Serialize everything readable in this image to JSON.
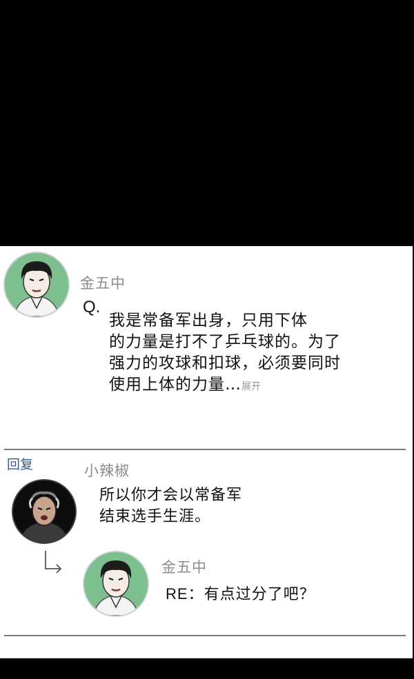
{
  "comment": {
    "username": "金五中",
    "q_prefix": "Q.",
    "lines": [
      "我是常备军出身，只用下体",
      "的力量是打不了乒乓球的。为了",
      "强力的攻球和扣球，必须要同时",
      "使用上体的力量…"
    ],
    "expand_label": "展开",
    "avatar_icon": "male-athlete-avatar-icon",
    "avatar_bg": "#7dbf8e"
  },
  "reply_section": {
    "label": "回复",
    "reply": {
      "username": "小辣椒",
      "lines": [
        "所以你才会以常备军",
        "结束选手生涯。"
      ],
      "avatar_icon": "older-man-avatar-icon"
    },
    "nested_reply": {
      "username": "金五中",
      "prefix": "RE：",
      "text": "有点过分了吧？",
      "avatar_icon": "male-athlete-avatar-icon",
      "avatar_bg": "#7dbf8e"
    }
  },
  "colors": {
    "panel_bg": "#ffffff",
    "username": "#8c8c8c",
    "reply_label": "#3a5a8c",
    "divider": "#777777"
  }
}
